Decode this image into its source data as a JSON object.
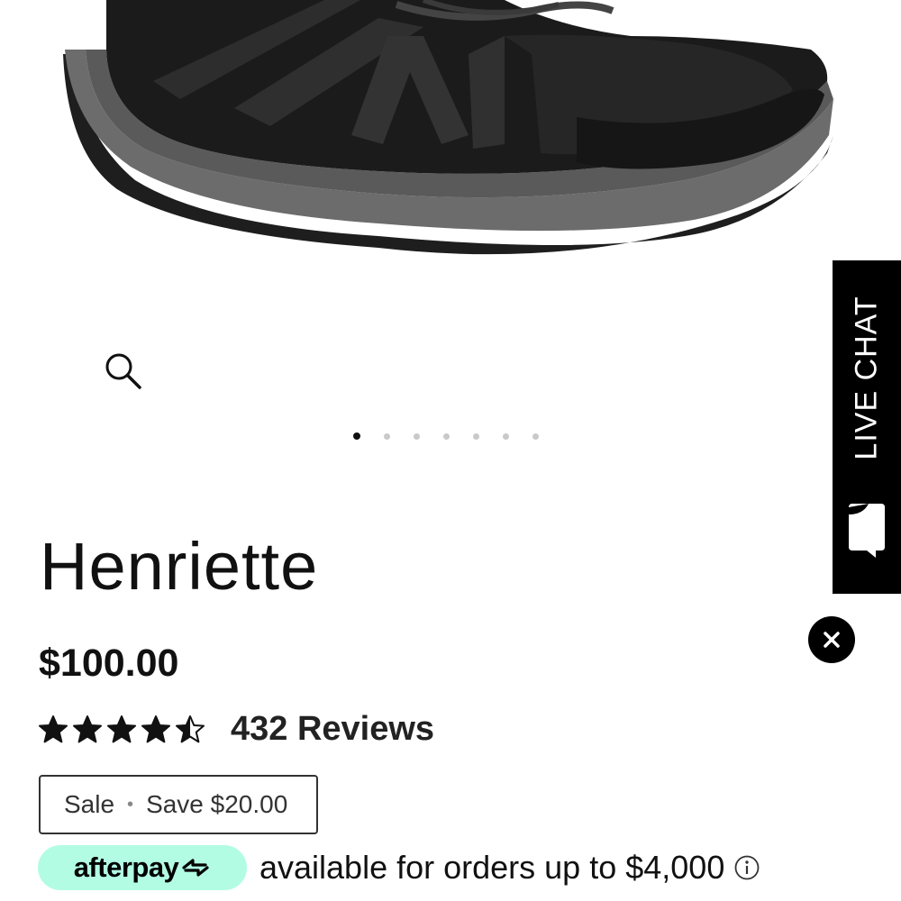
{
  "product": {
    "image_icon": "shoe-image",
    "title": "Henriette",
    "price": "$100.00",
    "rating": 4.5,
    "rating_max": 5,
    "reviews_label": "432 Reviews",
    "sale_label": "Sale",
    "sale_separator": "•",
    "save_label": "Save $20.00"
  },
  "carousel": {
    "dot_count": 7,
    "active_index": 0
  },
  "afterpay": {
    "logo_text": "afterpay",
    "text": "available for orders up to $4,000",
    "badge_color": "#b2fce4"
  },
  "live_chat": {
    "label": "LIVE CHAT"
  },
  "icons": {
    "zoom": "search-icon",
    "close": "close-icon",
    "info": "info-icon",
    "chat": "chat-bubble-icon",
    "afterpay": "afterpay-arrows-icon"
  }
}
